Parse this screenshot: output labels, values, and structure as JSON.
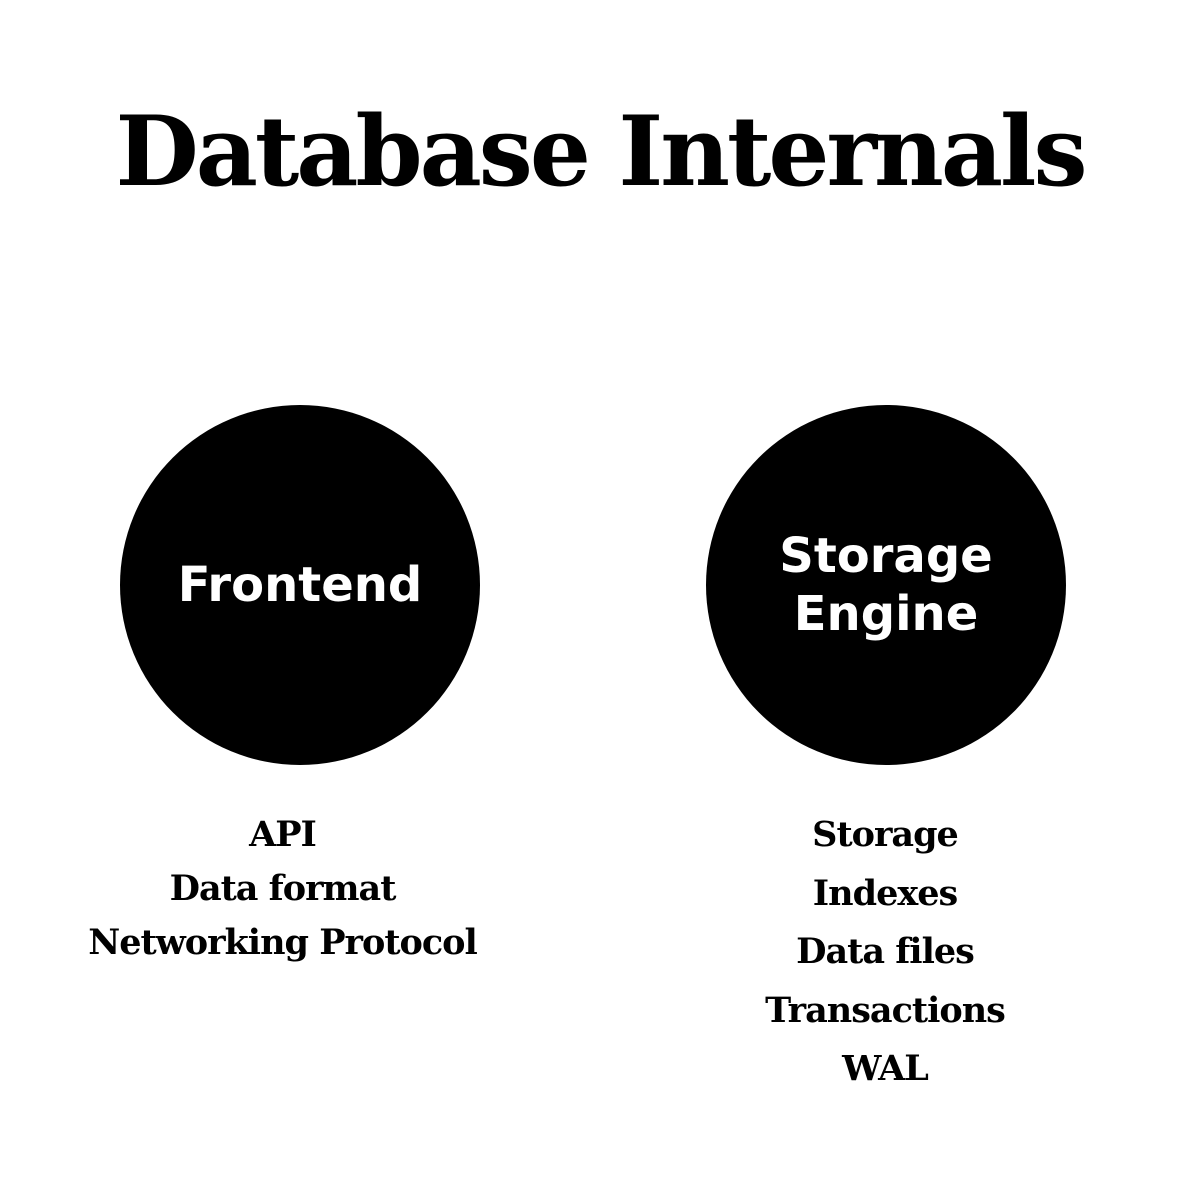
{
  "title": "Database Internals",
  "nodes": [
    {
      "label": "Frontend",
      "items": [
        "API",
        "Data format",
        "Networking Protocol"
      ]
    },
    {
      "label": "Storage Engine",
      "items": [
        "Storage",
        "Indexes",
        "Data files",
        "Transactions",
        "WAL"
      ]
    }
  ]
}
